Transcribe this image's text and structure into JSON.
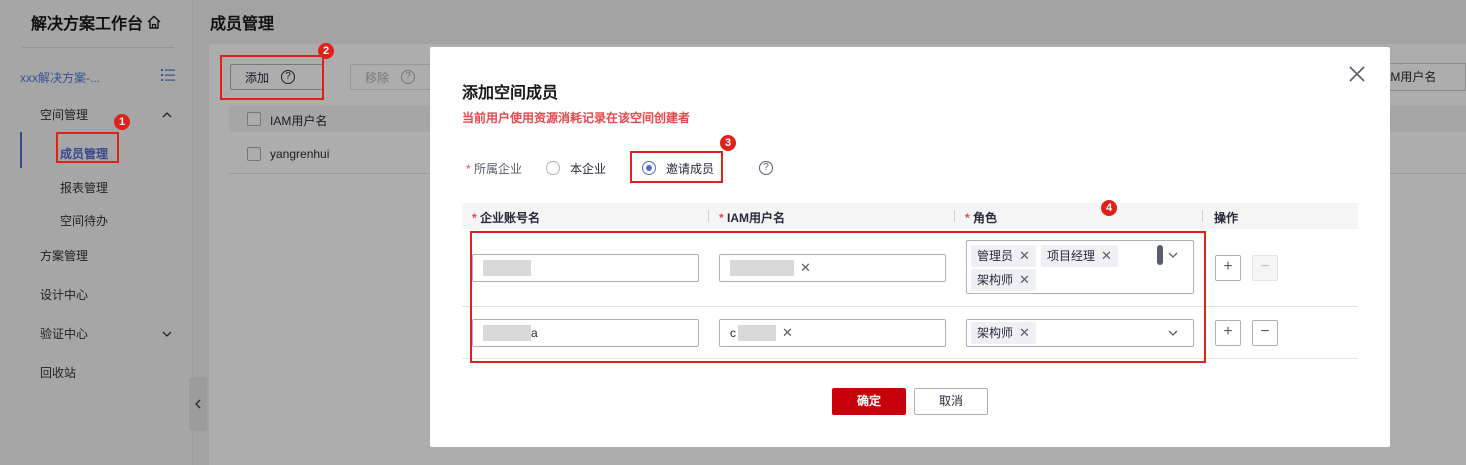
{
  "sidebar": {
    "brand": "解决方案工作台",
    "project": "xxx解决方案-...",
    "items": [
      {
        "label": "空间管理"
      },
      {
        "label": "成员管理"
      },
      {
        "label": "报表管理"
      },
      {
        "label": "空间待办"
      },
      {
        "label": "方案管理"
      },
      {
        "label": "设计中心"
      },
      {
        "label": "验证中心"
      },
      {
        "label": "回收站"
      }
    ]
  },
  "main": {
    "title": "成员管理",
    "add_label": "添加",
    "remove_label": "移除",
    "filter_label": "IAM用户名",
    "table": {
      "header": "IAM用户名",
      "rows": [
        {
          "username": "yangrenhui"
        }
      ]
    }
  },
  "dialog": {
    "title": "添加空间成员",
    "warning": "当前用户使用资源消耗记录在该空间创建者",
    "field_label": "所属企业",
    "required_mark": "*",
    "options": [
      {
        "label": "本企业",
        "checked": false
      },
      {
        "label": "邀请成员",
        "checked": true
      }
    ],
    "help": "?",
    "columns": [
      "企业账号名",
      "IAM用户名",
      "角色",
      "操作"
    ],
    "rows": [
      {
        "account_suffix": "",
        "roles": [
          "管理员",
          "项目经理",
          "架构师"
        ]
      },
      {
        "account_suffix": "a",
        "iam_prefix": "c",
        "roles": [
          "架构师"
        ]
      }
    ],
    "confirm_label": "确定",
    "cancel_label": "取消"
  },
  "annotations": [
    "1",
    "2",
    "3",
    "4"
  ],
  "colors": {
    "primary": "#c7000b",
    "accent": "#526ecc",
    "annotation": "#e0201a"
  }
}
